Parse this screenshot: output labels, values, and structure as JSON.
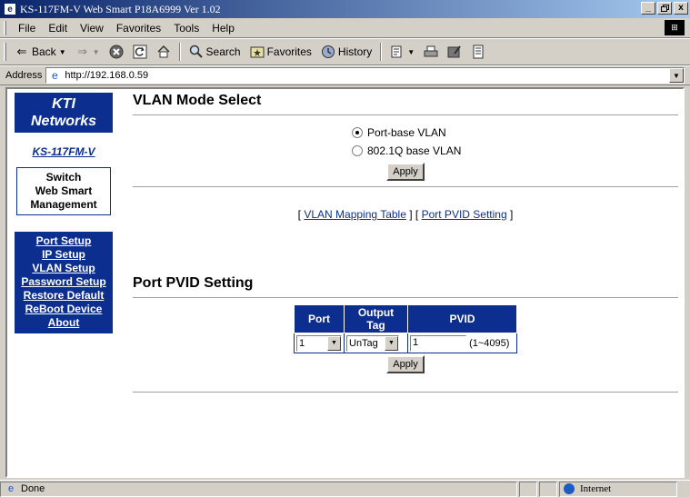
{
  "window": {
    "title": "KS-117FM-V Web Smart P18A6999 Ver 1.02",
    "controls": {
      "minimize": "_",
      "restore": " ",
      "close": "x"
    }
  },
  "menubar": [
    "File",
    "Edit",
    "View",
    "Favorites",
    "Tools",
    "Help"
  ],
  "toolbar": {
    "back": "Back",
    "search": "Search",
    "favorites": "Favorites",
    "history": "History"
  },
  "address": {
    "label": "Address",
    "url": "http://192.168.0.59"
  },
  "nav": {
    "logo_line1": "KTI",
    "logo_line2": "Networks",
    "model": "KS-117FM-V",
    "mgmt": [
      "Switch",
      "Web Smart",
      "Management"
    ],
    "items": [
      "Port Setup",
      "IP Setup",
      "VLAN Setup",
      "Password Setup",
      "Restore Default",
      "ReBoot Device",
      "About"
    ]
  },
  "vlan_mode": {
    "title": "VLAN Mode Select",
    "options": [
      {
        "label": "Port-base VLAN",
        "checked": true
      },
      {
        "label": "802.1Q base VLAN",
        "checked": false
      }
    ],
    "apply": "Apply"
  },
  "links": {
    "open1": "[",
    "mapping": "VLAN Mapping Table",
    "mid": "] [",
    "pvid": "Port PVID Setting",
    "close1": "]"
  },
  "pvid_setting": {
    "title": "Port PVID Setting",
    "headers": [
      "Port",
      "Output Tag",
      "PVID"
    ],
    "port_value": "1",
    "output_tag_value": "UnTag",
    "pvid_value": "1",
    "range_hint": "(1~4095)",
    "apply": "Apply"
  },
  "status": {
    "text": "Done",
    "zone": "Internet"
  },
  "colors": {
    "nav_blue": "#0c2f8f",
    "titlebar_start": "#0a246a",
    "titlebar_end": "#a6caf0"
  }
}
